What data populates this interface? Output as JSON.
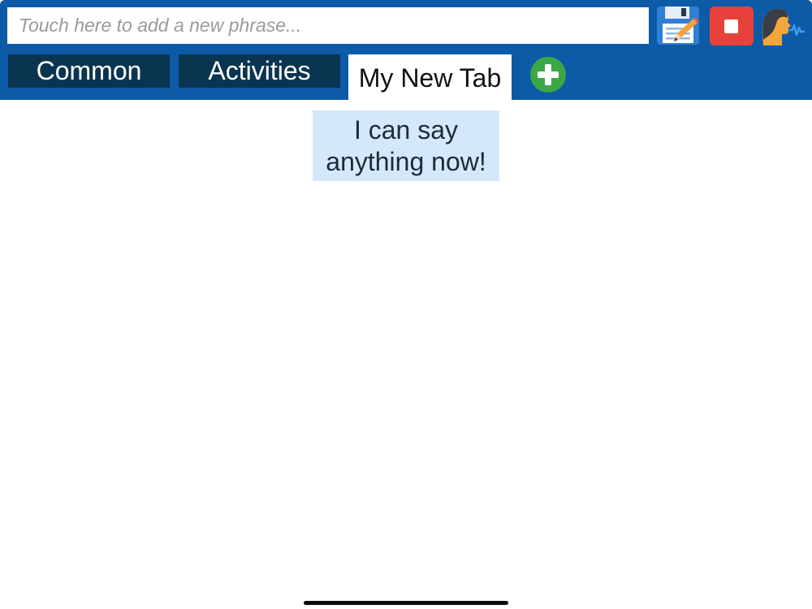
{
  "toolbar": {
    "phrase_placeholder": "Touch here to add a new phrase...",
    "phrase_value": "",
    "icons": {
      "save": "floppy-disk-pencil-icon",
      "stop": "stop-icon",
      "speak": "speaking-head-icon",
      "add_tab": "plus-circle-icon"
    }
  },
  "tabs": [
    {
      "label": "Common",
      "active": false
    },
    {
      "label": "Activities",
      "active": false
    },
    {
      "label": "My New Tab",
      "active": true
    }
  ],
  "phrases": [
    {
      "text": "I can say anything now!"
    }
  ],
  "colors": {
    "header": "#0d5aa7",
    "inactive_tab": "#0a3550",
    "active_tab": "#ffffff",
    "phrase_tile": "#d4e8fb",
    "stop_button": "#e8403a",
    "add_button": "#3aa845"
  }
}
